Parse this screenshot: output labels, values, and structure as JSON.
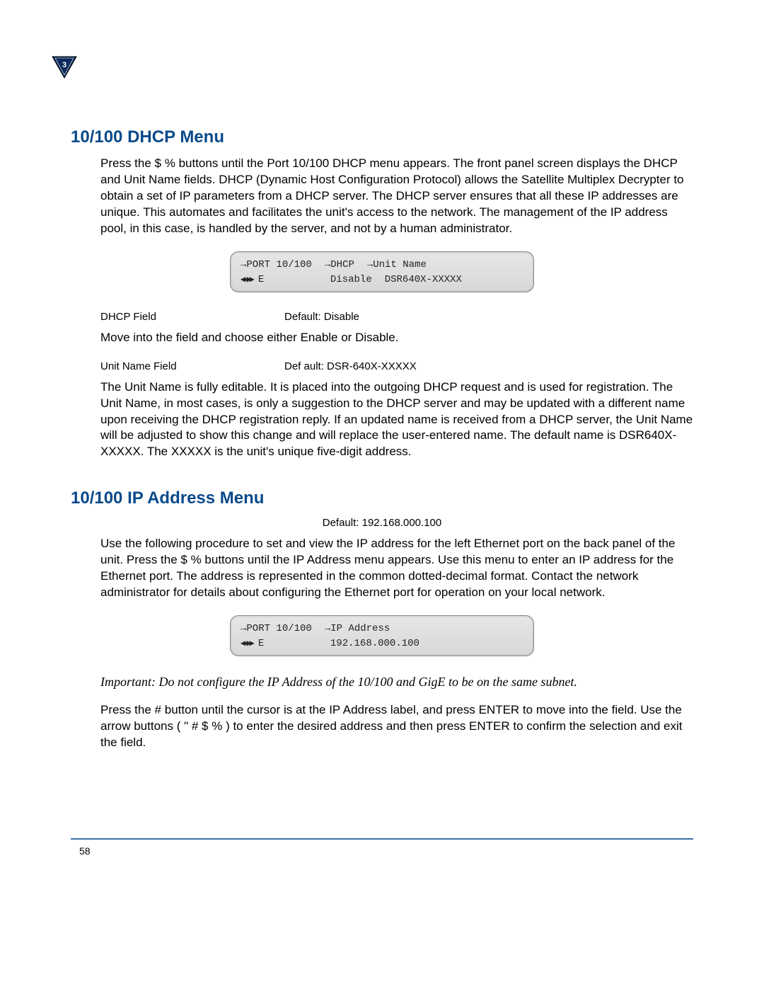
{
  "chapter_number": "3",
  "page_number": "58",
  "section1": {
    "title": "10/100 DHCP Menu",
    "intro_a": "Press the ",
    "intro_symbols": "$ %",
    "intro_b": " buttons until the Port 10/100 DHCP menu appears. The front panel screen displays the DHCP and Unit Name fields. DHCP (Dynamic Host Configuration Protocol) allows the Satellite Multiplex Decrypter to obtain a set of IP parameters from a DHCP server. The DHCP server ensures that all these IP addresses are unique. This automates and facilitates the unit's access to the network. The management of the IP address pool, in this case, is handled by the server, and not by a human administrator.",
    "lcd": {
      "l1a": "PORT 10/100",
      "l1b": "DHCP",
      "l1c": "Unit Name",
      "l2a": "E",
      "l2b": "Disable",
      "l2c": "DSR640X-XXXXX"
    },
    "dhcp_field_label": "DHCP Field",
    "dhcp_field_default": "Default: Disable",
    "dhcp_instruction": "Move into the field and choose either Enable or Disable.",
    "unitname_label": "Unit Name Field",
    "unitname_default": "Def ault: DSR-640X-XXXXX",
    "unitname_text": "The Unit Name is fully editable. It is placed into the outgoing DHCP request and is used for registration. The Unit Name, in most cases, is only a suggestion to the DHCP server and may be updated with a different name upon receiving the DHCP registration reply. If an updated name is received from a DHCP server, the Unit Name will be adjusted to show this change and will replace the user-entered name. The default name is DSR640X-XXXXX. The XXXXX is the unit's unique five-digit address."
  },
  "section2": {
    "title": "10/100 IP Address Menu",
    "default_line": "Default: 192.168.000.100",
    "intro_a": "Use the following procedure to set and view the IP address for the left Ethernet port on the back panel of the unit. Press the ",
    "intro_symbols": "$ %",
    "intro_b": " buttons until the IP Address menu appears. Use this menu to enter an IP address for the Ethernet port. The address is represented in the common dotted-decimal format. Contact the network administrator for details about configuring the Ethernet port for operation on your local network.",
    "lcd": {
      "l1a": "PORT 10/100",
      "l1b": "IP Address",
      "l2a": "E",
      "l2b": "192.168.000.100"
    },
    "important": "Important:  Do not configure the IP Address of the 10/100 and GigE to be on the same subnet.",
    "press_a": "Press the ",
    "press_sym1": "#",
    "press_b": " button until the cursor is at the IP Address label, and press ENTER to move into the field. Use the arrow buttons ( ",
    "press_sym2": "\"  #  $  %",
    "press_c": " ) to enter the desired address and then press ENTER to confirm the selection and exit the field."
  }
}
